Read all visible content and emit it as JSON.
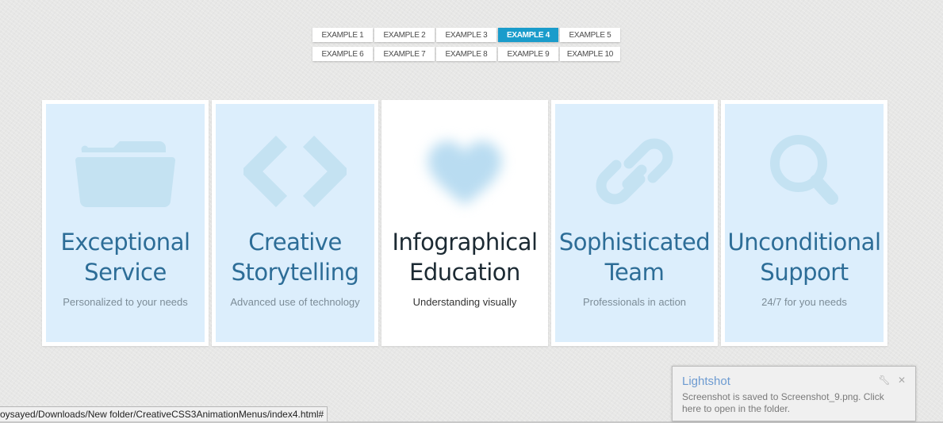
{
  "nav": {
    "row1": [
      "EXAMPLE 1",
      "EXAMPLE 2",
      "EXAMPLE 3",
      "EXAMPLE 4",
      "EXAMPLE 5"
    ],
    "row2": [
      "EXAMPLE 6",
      "EXAMPLE 7",
      "EXAMPLE 8",
      "EXAMPLE 9",
      "EXAMPLE 10"
    ],
    "active": "EXAMPLE 4",
    "accent": "#1a9ccb"
  },
  "menu": {
    "items": [
      {
        "icon": "folder-icon",
        "title1": "Exceptional",
        "title2": "Service",
        "subtitle": "Personalized to your needs"
      },
      {
        "icon": "code-icon",
        "title1": "Creative",
        "title2": "Storytelling",
        "subtitle": "Advanced use of technology"
      },
      {
        "icon": "heart-icon",
        "title1": "Infographical",
        "title2": "Education",
        "subtitle": "Understanding visually"
      },
      {
        "icon": "link-icon",
        "title1": "Sophisticated",
        "title2": "Team",
        "subtitle": "Professionals in action"
      },
      {
        "icon": "search-icon",
        "title1": "Unconditional",
        "title2": "Support",
        "subtitle": "24/7 for you needs"
      }
    ],
    "active_index": 2,
    "card_color": "#dceefc",
    "icon_color": "#c4e2f2",
    "title_color": "#2d6d97"
  },
  "statusbar": {
    "url": "oysayed/Downloads/New folder/CreativeCSS3AnimationMenus/index4.html#"
  },
  "toast": {
    "title": "Lightshot",
    "text": "Screenshot is saved to Screenshot_9.png. Click here to open in the folder.",
    "icons": [
      "wrench-icon",
      "close-icon"
    ]
  }
}
